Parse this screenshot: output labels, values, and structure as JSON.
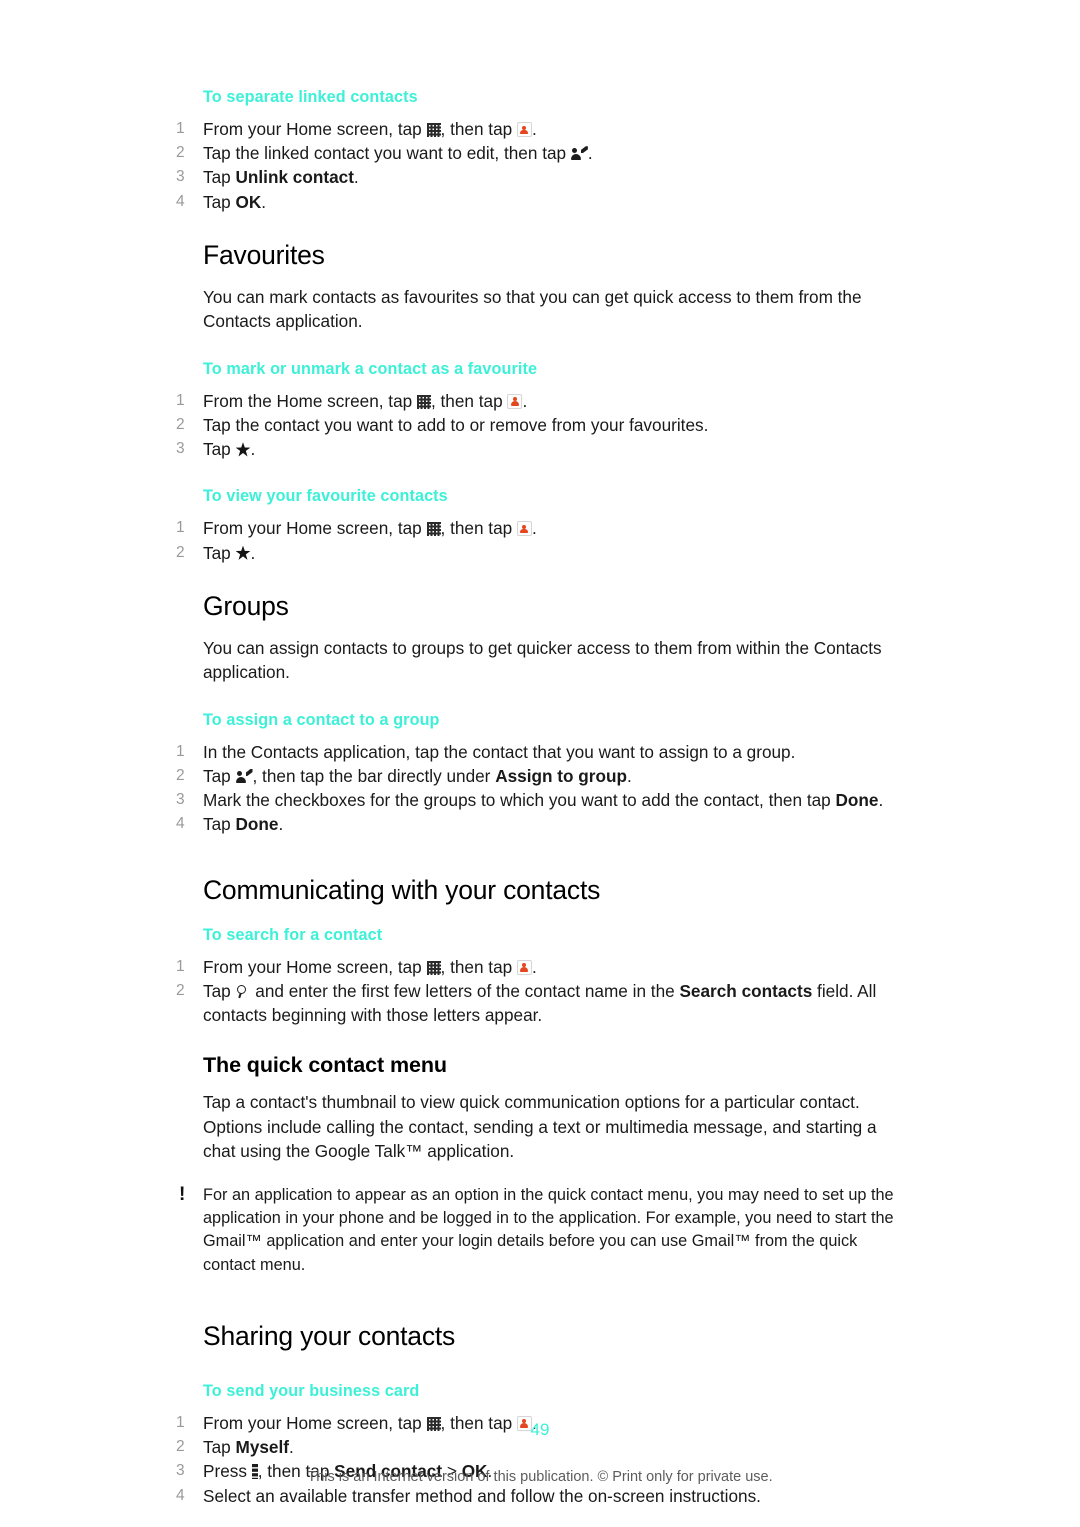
{
  "document": {
    "page_number": "49",
    "imprint": "This is an Internet version of this publication. © Print only for private use.",
    "accent_color": "#3df0d8",
    "step_number_color": "#9a9a9a",
    "body_color": "#1a1a1a"
  },
  "sections": {
    "separate_linked": {
      "heading": "To separate linked contacts",
      "steps": [
        {
          "num": "1",
          "a": "From your Home screen, tap ",
          "icon1": "app-drawer-grid-icon",
          "b": ", then tap ",
          "icon2": "contacts-app-icon",
          "c": "."
        },
        {
          "num": "2",
          "a": "Tap the linked contact you want to edit, then tap ",
          "icon1": "edit-contact-icon",
          "b": "."
        },
        {
          "num": "3",
          "a": "Tap ",
          "bold": "Unlink contact",
          "b": "."
        },
        {
          "num": "4",
          "a": "Tap ",
          "bold": "OK",
          "b": "."
        }
      ]
    },
    "favourites": {
      "heading": "Favourites",
      "intro": "You can mark contacts as favourites so that you can get quick access to them from the Contacts application.",
      "mark_unmark": {
        "heading": "To mark or unmark a contact as a favourite",
        "steps": [
          {
            "num": "1",
            "a": "From the Home screen, tap ",
            "icon1": "app-drawer-grid-icon",
            "b": ", then tap ",
            "icon2": "contacts-app-icon",
            "c": "."
          },
          {
            "num": "2",
            "a": "Tap the contact you want to add to or remove from your favourites."
          },
          {
            "num": "3",
            "a": "Tap ",
            "icon1": "star-icon",
            "b": "."
          }
        ]
      },
      "view_favourites": {
        "heading": "To view your favourite contacts",
        "steps": [
          {
            "num": "1",
            "a": "From your Home screen, tap ",
            "icon1": "app-drawer-grid-icon",
            "b": ", then tap ",
            "icon2": "contacts-app-icon",
            "c": "."
          },
          {
            "num": "2",
            "a": "Tap ",
            "icon1": "star-icon",
            "b": "."
          }
        ]
      }
    },
    "groups": {
      "heading": "Groups",
      "intro": "You can assign contacts to groups to get quicker access to them from within the Contacts application.",
      "assign": {
        "heading": "To assign a contact to a group",
        "steps": [
          {
            "num": "1",
            "a": "In the Contacts application, tap the contact that you want to assign to a group."
          },
          {
            "num": "2",
            "a": "Tap ",
            "icon1": "edit-contact-icon",
            "b": ", then tap the bar directly under ",
            "bold": "Assign to group",
            "c": "."
          },
          {
            "num": "3",
            "a": "Mark the checkboxes for the groups to which you want to add the contact, then tap ",
            "bold": "Done",
            "b": "."
          },
          {
            "num": "4",
            "a": "Tap ",
            "bold": "Done",
            "b": "."
          }
        ]
      }
    },
    "communicating": {
      "heading": "Communicating with your contacts",
      "search": {
        "heading": "To search for a contact",
        "steps": [
          {
            "num": "1",
            "a": "From your Home screen, tap ",
            "icon1": "app-drawer-grid-icon",
            "b": ", then tap ",
            "icon2": "contacts-app-icon",
            "c": "."
          },
          {
            "num": "2",
            "a": "Tap ",
            "icon1": "search-icon",
            "b": " and enter the first few letters of the contact name in the ",
            "bold": "Search contacts",
            "c": " field. All contacts beginning with those letters appear."
          }
        ]
      },
      "quick_menu": {
        "heading": "The quick contact menu",
        "body": "Tap a contact's thumbnail to view quick communication options for a particular contact. Options include calling the contact, sending a text or multimedia message, and starting a chat using the Google Talk™ application.",
        "note_icon": "exclamation-icon",
        "note": "For an application to appear as an option in the quick contact menu, you may need to set up the application in your phone and be logged in to the application. For example, you need to start the Gmail™ application and enter your login details before you can use Gmail™ from the quick contact menu."
      }
    },
    "sharing": {
      "heading": "Sharing your contacts",
      "business_card": {
        "heading": "To send your business card",
        "steps": [
          {
            "num": "1",
            "a": "From your Home screen, tap ",
            "icon1": "app-drawer-grid-icon",
            "b": ", then tap ",
            "icon2": "contacts-app-icon",
            "c": "."
          },
          {
            "num": "2",
            "a": "Tap ",
            "bold": "Myself",
            "b": "."
          },
          {
            "num": "3",
            "a": "Press ",
            "icon1": "menu-key-icon",
            "b": ", then tap ",
            "bold": "Send contact",
            "c": " > ",
            "bold2": "OK",
            "d": "."
          },
          {
            "num": "4",
            "a": "Select an available transfer method and follow the on-screen instructions."
          }
        ]
      }
    }
  }
}
